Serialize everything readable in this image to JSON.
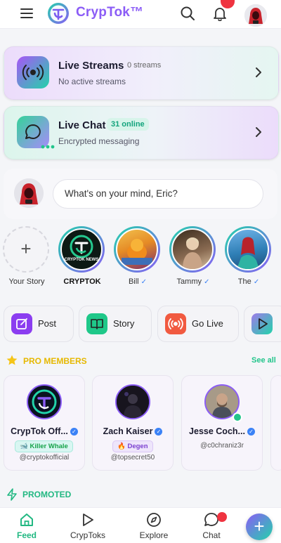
{
  "header": {
    "app_name": "CrypTok™",
    "notification_dot_color": "#ef3340",
    "icons": [
      "menu-icon",
      "cryptok-logo-icon",
      "search-icon",
      "bell-icon",
      "hacker-avatar-icon"
    ]
  },
  "cards": {
    "live_streams": {
      "title": "Live Streams",
      "count": "0 streams",
      "subtitle": "No active streams",
      "icon": "broadcast-icon"
    },
    "live_chat": {
      "title": "Live Chat",
      "badge": "31 online",
      "subtitle": "Encrypted messaging",
      "icon": "chat-bubble-icon"
    }
  },
  "composer": {
    "placeholder": "What's on your mind, Eric?"
  },
  "stories": [
    {
      "label": "Your Story"
    },
    {
      "label": "CRYPTOK",
      "logo_text": "CRYPTOK NEWS"
    },
    {
      "label": "Bill",
      "verified": "✓"
    },
    {
      "label": "Tammy",
      "verified": "✓"
    },
    {
      "label": "The",
      "verified": "✓"
    }
  ],
  "actions": [
    {
      "label": "Post",
      "icon": "edit-icon",
      "color": "#8b3df0"
    },
    {
      "label": "Story",
      "icon": "book-icon",
      "color": "#1fc889"
    },
    {
      "label": "Go Live",
      "icon": "broadcast-icon",
      "color": "#f15a40"
    },
    {
      "label": "",
      "icon": "play-icon",
      "color": "#9f7aea"
    }
  ],
  "pro_members": {
    "title": "PRO MEMBERS",
    "see_all": "See all",
    "members": [
      {
        "name": "CrypTok Off...",
        "verified": "✓",
        "badge": "🐋 Killer Whale",
        "handle": "@cryptokofficial"
      },
      {
        "name": "Zach Kaiser",
        "verified": "✓",
        "badge": "🔥 Degen",
        "handle": "@topsecret50"
      },
      {
        "name": "Jesse Coch...",
        "verified": "✓",
        "badge": "",
        "handle": "@c0chraniz3r"
      }
    ]
  },
  "promoted": {
    "title": "PROMOTED"
  },
  "nav": {
    "items": [
      {
        "label": "Feed",
        "icon": "home-icon"
      },
      {
        "label": "CrypToks",
        "icon": "play-icon"
      },
      {
        "label": "Explore",
        "icon": "compass-icon"
      },
      {
        "label": "Chat",
        "icon": "chat-bubble-icon"
      }
    ],
    "fab": "+",
    "accent": "#22b882"
  }
}
